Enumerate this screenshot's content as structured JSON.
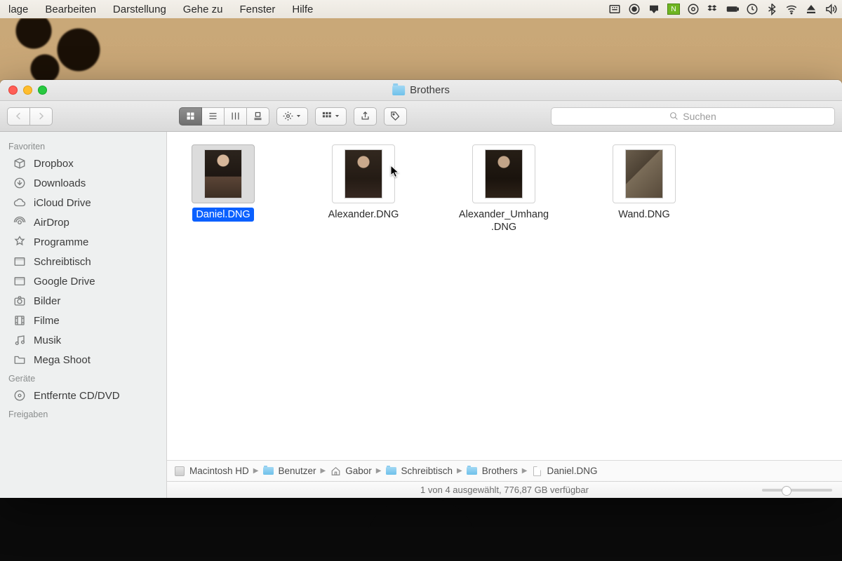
{
  "menubar": {
    "items": [
      "lage",
      "Bearbeiten",
      "Darstellung",
      "Gehe zu",
      "Fenster",
      "Hilfe"
    ]
  },
  "window": {
    "title": "Brothers",
    "search_placeholder": "Suchen"
  },
  "sidebar": {
    "sections": [
      {
        "title": "Favoriten",
        "items": [
          {
            "icon": "box",
            "label": "Dropbox"
          },
          {
            "icon": "download",
            "label": "Downloads"
          },
          {
            "icon": "cloud",
            "label": "iCloud Drive"
          },
          {
            "icon": "airdrop",
            "label": "AirDrop"
          },
          {
            "icon": "app",
            "label": "Programme"
          },
          {
            "icon": "desktop",
            "label": "Schreibtisch"
          },
          {
            "icon": "desktop",
            "label": "Google Drive"
          },
          {
            "icon": "camera",
            "label": "Bilder"
          },
          {
            "icon": "film",
            "label": "Filme"
          },
          {
            "icon": "music",
            "label": "Musik"
          },
          {
            "icon": "folder",
            "label": "Mega Shoot"
          }
        ]
      },
      {
        "title": "Geräte",
        "items": [
          {
            "icon": "disc",
            "label": "Entfernte CD/DVD"
          }
        ]
      },
      {
        "title": "Freigaben",
        "items": []
      }
    ]
  },
  "files": [
    {
      "name": "Daniel.DNG",
      "thumb": "t1",
      "selected": true
    },
    {
      "name": "Alexander.DNG",
      "thumb": "t2",
      "selected": false
    },
    {
      "name": "Alexander_Umhang.DNG",
      "thumb": "t3",
      "selected": false
    },
    {
      "name": "Wand.DNG",
      "thumb": "t4",
      "selected": false
    }
  ],
  "path": [
    {
      "icon": "disk",
      "label": "Macintosh HD"
    },
    {
      "icon": "folder",
      "label": "Benutzer"
    },
    {
      "icon": "home",
      "label": "Gabor"
    },
    {
      "icon": "folder",
      "label": "Schreibtisch"
    },
    {
      "icon": "folder",
      "label": "Brothers"
    },
    {
      "icon": "doc",
      "label": "Daniel.DNG"
    }
  ],
  "status": "1 von 4 ausgewählt, 776,87 GB verfügbar"
}
